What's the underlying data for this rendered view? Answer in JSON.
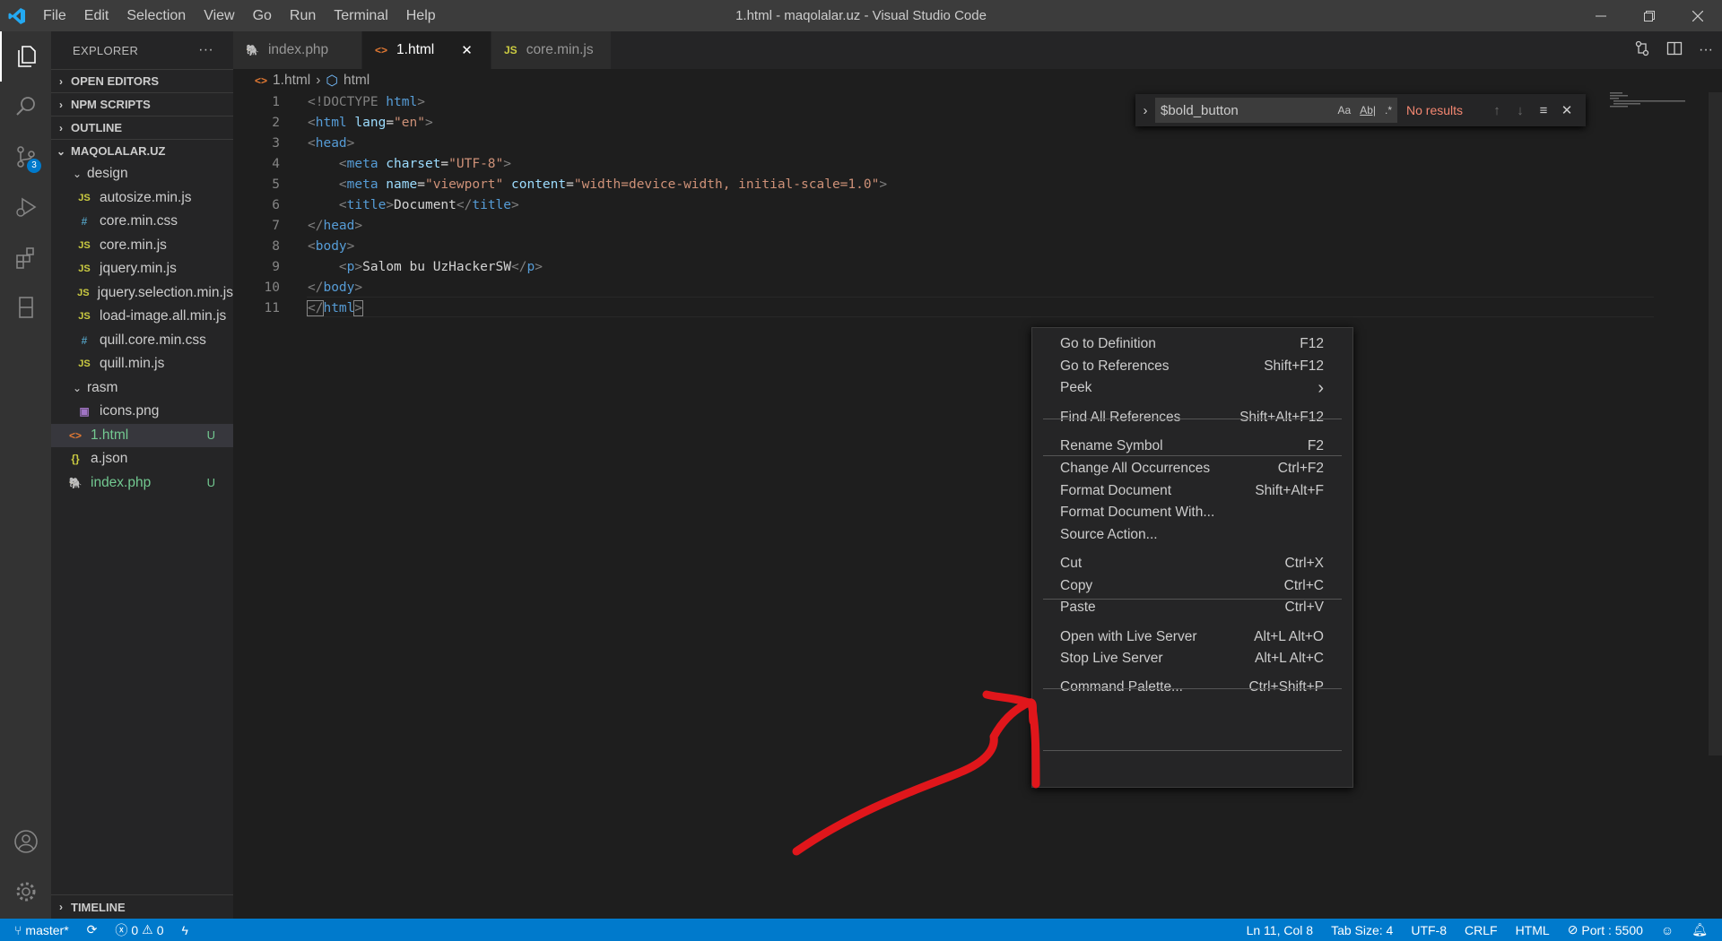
{
  "window": {
    "title": "1.html - maqolalar.uz - Visual Studio Code",
    "menu": [
      "File",
      "Edit",
      "Selection",
      "View",
      "Go",
      "Run",
      "Terminal",
      "Help"
    ]
  },
  "activity_bar": {
    "items": [
      "files-icon",
      "search-icon",
      "source-control-icon",
      "run-debug-icon",
      "extensions-icon",
      "remote-explorer-icon"
    ],
    "source_control_badge": "3",
    "bottom": [
      "account-icon",
      "settings-gear-icon"
    ]
  },
  "sidebar": {
    "title": "EXPLORER",
    "more": "···",
    "sections": {
      "open_editors": "OPEN EDITORS",
      "npm_scripts": "NPM SCRIPTS",
      "outline": "OUTLINE",
      "project": "MAQOLALAR.UZ",
      "timeline": "TIMELINE"
    },
    "folder_design": "design",
    "design_files": [
      {
        "icon": "JS",
        "type": "js",
        "name": "autosize.min.js"
      },
      {
        "icon": "#",
        "type": "css",
        "name": "core.min.css"
      },
      {
        "icon": "JS",
        "type": "js",
        "name": "core.min.js"
      },
      {
        "icon": "JS",
        "type": "js",
        "name": "jquery.min.js"
      },
      {
        "icon": "JS",
        "type": "js",
        "name": "jquery.selection.min.js"
      },
      {
        "icon": "JS",
        "type": "js",
        "name": "load-image.all.min.js"
      },
      {
        "icon": "#",
        "type": "css",
        "name": "quill.core.min.css"
      },
      {
        "icon": "JS",
        "type": "js",
        "name": "quill.min.js"
      }
    ],
    "folder_rasm": "rasm",
    "rasm_files": [
      {
        "name": "icons.png"
      }
    ],
    "root_files": [
      {
        "icon": "<>",
        "name": "1.html",
        "badge": "U"
      },
      {
        "icon": "{}",
        "name": "a.json",
        "badge": ""
      },
      {
        "icon": "php",
        "name": "index.php",
        "badge": "U"
      }
    ]
  },
  "tabs": [
    {
      "icon": "php",
      "label": "index.php"
    },
    {
      "icon": "<>",
      "label": "1.html"
    },
    {
      "icon": "JS",
      "label": "core.min.js"
    }
  ],
  "tab_close": "✕",
  "breadcrumb": {
    "file": "1.html",
    "symbol": "html"
  },
  "editor": {
    "line_numbers": [
      "1",
      "2",
      "3",
      "4",
      "5",
      "6",
      "7",
      "8",
      "9",
      "10",
      "11"
    ],
    "lines": {
      "l1": {
        "open": "<!DOCTYPE",
        "tag": " html",
        "close": ">"
      },
      "l2": {
        "lt": "<",
        "tag": "html",
        "attr": " lang",
        "eq": "=",
        "val": "\"en\"",
        "gt": ">"
      },
      "l3": {
        "lt": "<",
        "tag": "head",
        "gt": ">"
      },
      "l4": {
        "indent": "    ",
        "lt": "<",
        "tag": "meta",
        "attr": " charset",
        "eq": "=",
        "val": "\"UTF-8\"",
        "gt": ">"
      },
      "l5": {
        "indent": "    ",
        "lt": "<",
        "tag": "meta",
        "attr": " name",
        "eq": "=",
        "val": "\"viewport\"",
        "attr2": " content",
        "eq2": "=",
        "val2": "\"width=device-width, initial-scale=1.0\"",
        "gt": ">"
      },
      "l6": {
        "indent": "    ",
        "lt": "<",
        "tag": "title",
        "gt": ">",
        "text": "Document",
        "lt2": "</",
        "tag2": "title",
        "gt2": ">"
      },
      "l7": {
        "lt": "</",
        "tag": "head",
        "gt": ">"
      },
      "l8": {
        "lt": "<",
        "tag": "body",
        "gt": ">"
      },
      "l9": {
        "indent": "    ",
        "lt": "<",
        "tag": "p",
        "gt": ">",
        "text": "Salom bu UzHackerSW",
        "lt2": "</",
        "tag2": "p",
        "gt2": ">"
      },
      "l10": {
        "lt": "</",
        "tag": "body",
        "gt": ">"
      },
      "l11": {
        "lt": "</",
        "tag": "html",
        "gt": ">"
      }
    }
  },
  "find": {
    "toggle": "›",
    "value": "$bold_button",
    "options": [
      "Aa",
      "Ab|",
      ".*"
    ],
    "status": "No results",
    "prev": "↑",
    "next": "↓",
    "selection": "≡",
    "close": "✕"
  },
  "context_menu": {
    "items": [
      {
        "label": "Go to Definition",
        "shortcut": "F12"
      },
      {
        "label": "Go to References",
        "shortcut": "Shift+F12"
      },
      {
        "label": "Peek",
        "shortcut": "›"
      },
      {
        "label": "Find All References",
        "shortcut": "Shift+Alt+F12"
      },
      {
        "label": "Rename Symbol",
        "shortcut": "F2"
      },
      {
        "label": "Change All Occurrences",
        "shortcut": "Ctrl+F2"
      },
      {
        "label": "Format Document",
        "shortcut": "Shift+Alt+F"
      },
      {
        "label": "Format Document With...",
        "shortcut": ""
      },
      {
        "label": "Source Action...",
        "shortcut": ""
      },
      {
        "label": "Cut",
        "shortcut": "Ctrl+X"
      },
      {
        "label": "Copy",
        "shortcut": "Ctrl+C"
      },
      {
        "label": "Paste",
        "shortcut": "Ctrl+V"
      },
      {
        "label": "Open with Live Server",
        "shortcut": "Alt+L Alt+O"
      },
      {
        "label": "Stop Live Server",
        "shortcut": "Alt+L Alt+C"
      },
      {
        "label": "Command Palette...",
        "shortcut": "Ctrl+Shift+P"
      }
    ]
  },
  "annotation": {
    "color": "#e0161b"
  },
  "status_bar": {
    "branch": "master*",
    "errors": "0",
    "warnings": "0",
    "position": "Ln 11, Col 8",
    "tab_size": "Tab Size: 4",
    "encoding": "UTF-8",
    "eol": "CRLF",
    "language": "HTML",
    "port": "Port : 5500",
    "background": "#007acc"
  },
  "colors": {
    "accent": "#007acc",
    "untracked": "#73c991",
    "no_results": "#f48771"
  }
}
